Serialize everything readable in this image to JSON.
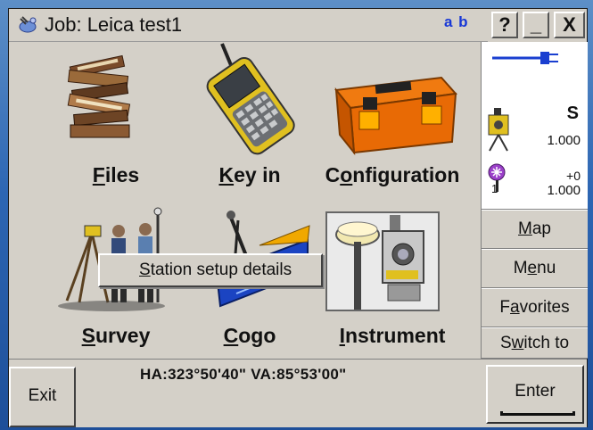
{
  "window": {
    "title": "Job: Leica test1"
  },
  "titlebar": {
    "ab_label": "a b",
    "help_label": "?",
    "minimize_label": "_",
    "close_label": "X"
  },
  "tiles": [
    {
      "label": "Files",
      "mnemonic": "F",
      "rest": "iles"
    },
    {
      "label": "Key in",
      "mnemonic": "K",
      "rest": "ey in"
    },
    {
      "label": "Configuration",
      "pre": "C",
      "mnemonic": "o",
      "rest": "nfiguration"
    },
    {
      "label": "Survey",
      "mnemonic": "S",
      "rest": "urvey"
    },
    {
      "label": "Cogo",
      "mnemonic": "C",
      "rest": "ogo"
    },
    {
      "label": "Instrument",
      "mnemonic": "I",
      "rest": "nstrument",
      "selected": true
    }
  ],
  "context_menu": {
    "items": [
      {
        "label": "Station setup details",
        "mnemonic": "S",
        "rest": "tation setup details"
      }
    ]
  },
  "status": {
    "instrument_code": "S",
    "instrument_value": "1.000",
    "target_offset": "+0",
    "target_value": "1.000",
    "target_number": "1"
  },
  "right_buttons": [
    {
      "label": "Map",
      "mnemonic": "M",
      "rest": "ap"
    },
    {
      "label": "Menu",
      "pre": "M",
      "mnemonic": "e",
      "rest": "nu"
    },
    {
      "label": "Favorites",
      "pre": "F",
      "mnemonic": "a",
      "rest": "vorites"
    },
    {
      "label": "Switch to",
      "pre": "S",
      "mnemonic": "w",
      "rest": "itch to"
    }
  ],
  "bottom": {
    "exit_label": "Exit",
    "coords": "HA:323°50'40\"  VA:85°53'00\"",
    "enter_label": "Enter"
  },
  "colors": {
    "ab_blue": "#1737d6",
    "battery_blue": "#1a3fd0",
    "target_purple": "#9b40c9"
  }
}
